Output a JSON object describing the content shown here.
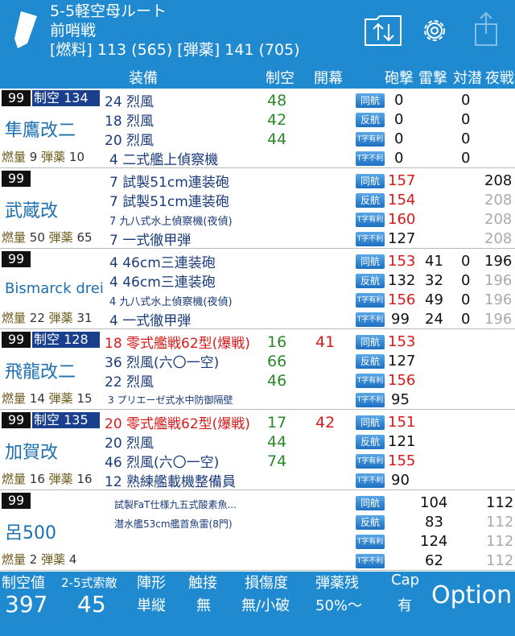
{
  "header": {
    "title": "5-5軽空母ルート",
    "formation": "前哨戦",
    "resources": "[燃料] 113 (565) [弾薬] 141 (705)"
  },
  "columns": {
    "equipment": "装備",
    "air_control": "制空",
    "opening": "開幕",
    "shelling": "砲撃",
    "torpedo": "雷撃",
    "asw": "対潜",
    "night": "夜戦"
  },
  "badges": [
    "同航",
    "反航",
    "T字有利",
    "T字不利"
  ],
  "ships": [
    {
      "level": "99",
      "air": "制空 134",
      "name": "隼鷹改二",
      "fuel_label": "燃量",
      "fuel": "9",
      "ammo_label": "弾薬",
      "ammo": "10",
      "equip": [
        "24 烈風",
        "18 烈風",
        "20 烈風",
        "4 二式艦上偵察機"
      ],
      "equip_air": [
        "48",
        "42",
        "44",
        ""
      ],
      "opening": [
        "",
        "",
        "",
        ""
      ],
      "shelling": [
        "0",
        "0",
        "0",
        "0"
      ],
      "torpedo": [
        "",
        "",
        "",
        ""
      ],
      "asw": [
        "0",
        "0",
        "0",
        "0"
      ],
      "night": [
        "",
        "",
        "",
        ""
      ]
    },
    {
      "level": "99",
      "air": "",
      "name": "武蔵改",
      "fuel_label": "燃量",
      "fuel": "50",
      "ammo_label": "弾薬",
      "ammo": "65",
      "equip": [
        "7 試製51cm連装砲",
        "7 試製51cm連装砲",
        "7 九八式水上偵察機(夜偵)",
        "7 一式徹甲弾"
      ],
      "equip_air": [
        "",
        "",
        "",
        ""
      ],
      "opening": [
        "",
        "",
        "",
        ""
      ],
      "shelling": [
        "157",
        "154",
        "160",
        "127"
      ],
      "torpedo": [
        "",
        "",
        "",
        ""
      ],
      "asw": [
        "",
        "",
        "",
        ""
      ],
      "night": [
        "208",
        "208",
        "208",
        "208"
      ]
    },
    {
      "level": "99",
      "air": "",
      "name": "Bismarck drei",
      "fuel_label": "燃量",
      "fuel": "22",
      "ammo_label": "弾薬",
      "ammo": "31",
      "equip": [
        "4 46cm三連装砲",
        "4 46cm三連装砲",
        "4 九八式水上偵察機(夜偵)",
        "4 一式徹甲弾"
      ],
      "equip_air": [
        "",
        "",
        "",
        ""
      ],
      "opening": [
        "",
        "",
        "",
        ""
      ],
      "shelling": [
        "153",
        "132",
        "156",
        "99"
      ],
      "torpedo": [
        "41",
        "32",
        "49",
        "24"
      ],
      "asw": [
        "0",
        "0",
        "0",
        "0"
      ],
      "night": [
        "196",
        "196",
        "196",
        "196"
      ]
    },
    {
      "level": "99",
      "air": "制空 128",
      "name": "飛龍改二",
      "fuel_label": "燃量",
      "fuel": "14",
      "ammo_label": "弾薬",
      "ammo": "15",
      "equip": [
        "18 零式艦戦62型(爆戦)",
        "36 烈風(六〇一空)",
        "22 烈風",
        "3 プリエーゼ式水中防御隔壁"
      ],
      "equip_air": [
        "16",
        "66",
        "46",
        ""
      ],
      "opening": [
        "41",
        "",
        "",
        ""
      ],
      "shelling": [
        "153",
        "127",
        "156",
        "95"
      ],
      "torpedo": [
        "",
        "",
        "",
        ""
      ],
      "asw": [
        "",
        "",
        "",
        ""
      ],
      "night": [
        "",
        "",
        "",
        ""
      ]
    },
    {
      "level": "99",
      "air": "制空 135",
      "name": "加賀改",
      "fuel_label": "燃量",
      "fuel": "16",
      "ammo_label": "弾薬",
      "ammo": "16",
      "equip": [
        "20 零式艦戦62型(爆戦)",
        "20 烈風",
        "46 烈風(六〇一空)",
        "12 熟練艦載機整備員"
      ],
      "equip_air": [
        "17",
        "44",
        "74",
        ""
      ],
      "opening": [
        "42",
        "",
        "",
        ""
      ],
      "shelling": [
        "151",
        "121",
        "155",
        "90"
      ],
      "torpedo": [
        "",
        "",
        "",
        ""
      ],
      "asw": [
        "",
        "",
        "",
        ""
      ],
      "night": [
        "",
        "",
        "",
        ""
      ]
    },
    {
      "level": "99",
      "air": "",
      "name": "呂500",
      "fuel_label": "燃量",
      "fuel": "2",
      "ammo_label": "弾薬",
      "ammo": "4",
      "equip": [
        "試製FaT仕様九五式酸素魚...",
        "潜水艦53cm艦首魚雷(8門)",
        "",
        ""
      ],
      "equip_air": [
        "",
        "",
        "",
        ""
      ],
      "opening": [
        "",
        "",
        "",
        ""
      ],
      "shelling": [
        "",
        "",
        "",
        ""
      ],
      "torpedo": [
        "104",
        "83",
        "124",
        "62"
      ],
      "asw": [
        "",
        "",
        "",
        ""
      ],
      "night": [
        "112",
        "112",
        "112",
        "112"
      ]
    }
  ],
  "footer": {
    "air_label": "制空値",
    "air_value": "397",
    "scout_label": "2-5式索敵",
    "scout_value": "45",
    "formation_label": "陣形",
    "formation_value": "単縦",
    "contact_label": "触接",
    "contact_value": "無",
    "damage_label": "損傷度",
    "damage_value": "無/小破",
    "ammo_label": "弾薬残",
    "ammo_value": "50%〜",
    "cap_label": "Cap",
    "cap_value": "有",
    "option_label": "Option"
  },
  "colors": {
    "header_bg": "#1f8ad0",
    "accent_red": "#d81a1a",
    "air_green": "#2a8a2a",
    "name_blue": "#1c70b0"
  }
}
